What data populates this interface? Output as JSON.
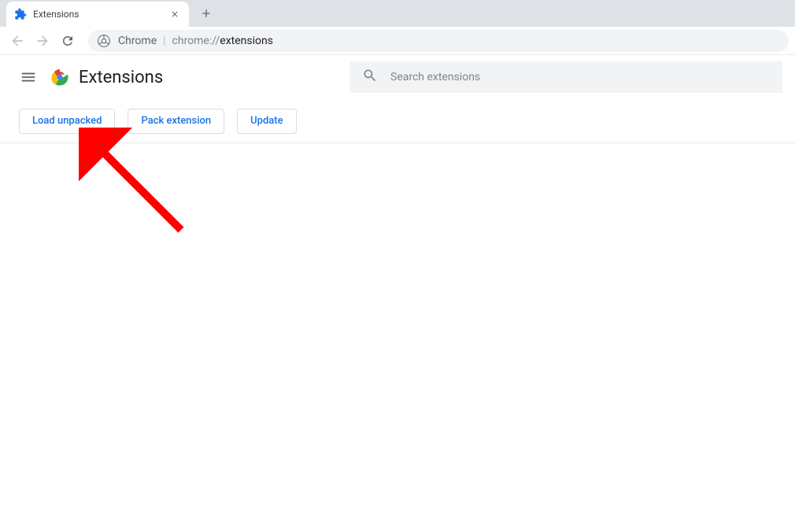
{
  "tab": {
    "title": "Extensions"
  },
  "omnibox": {
    "prefix": "Chrome",
    "path_muted": "chrome://",
    "path_bold": "extensions"
  },
  "header": {
    "title": "Extensions",
    "search_placeholder": "Search extensions"
  },
  "actions": {
    "load_unpacked": "Load unpacked",
    "pack_extension": "Pack extension",
    "update": "Update"
  }
}
